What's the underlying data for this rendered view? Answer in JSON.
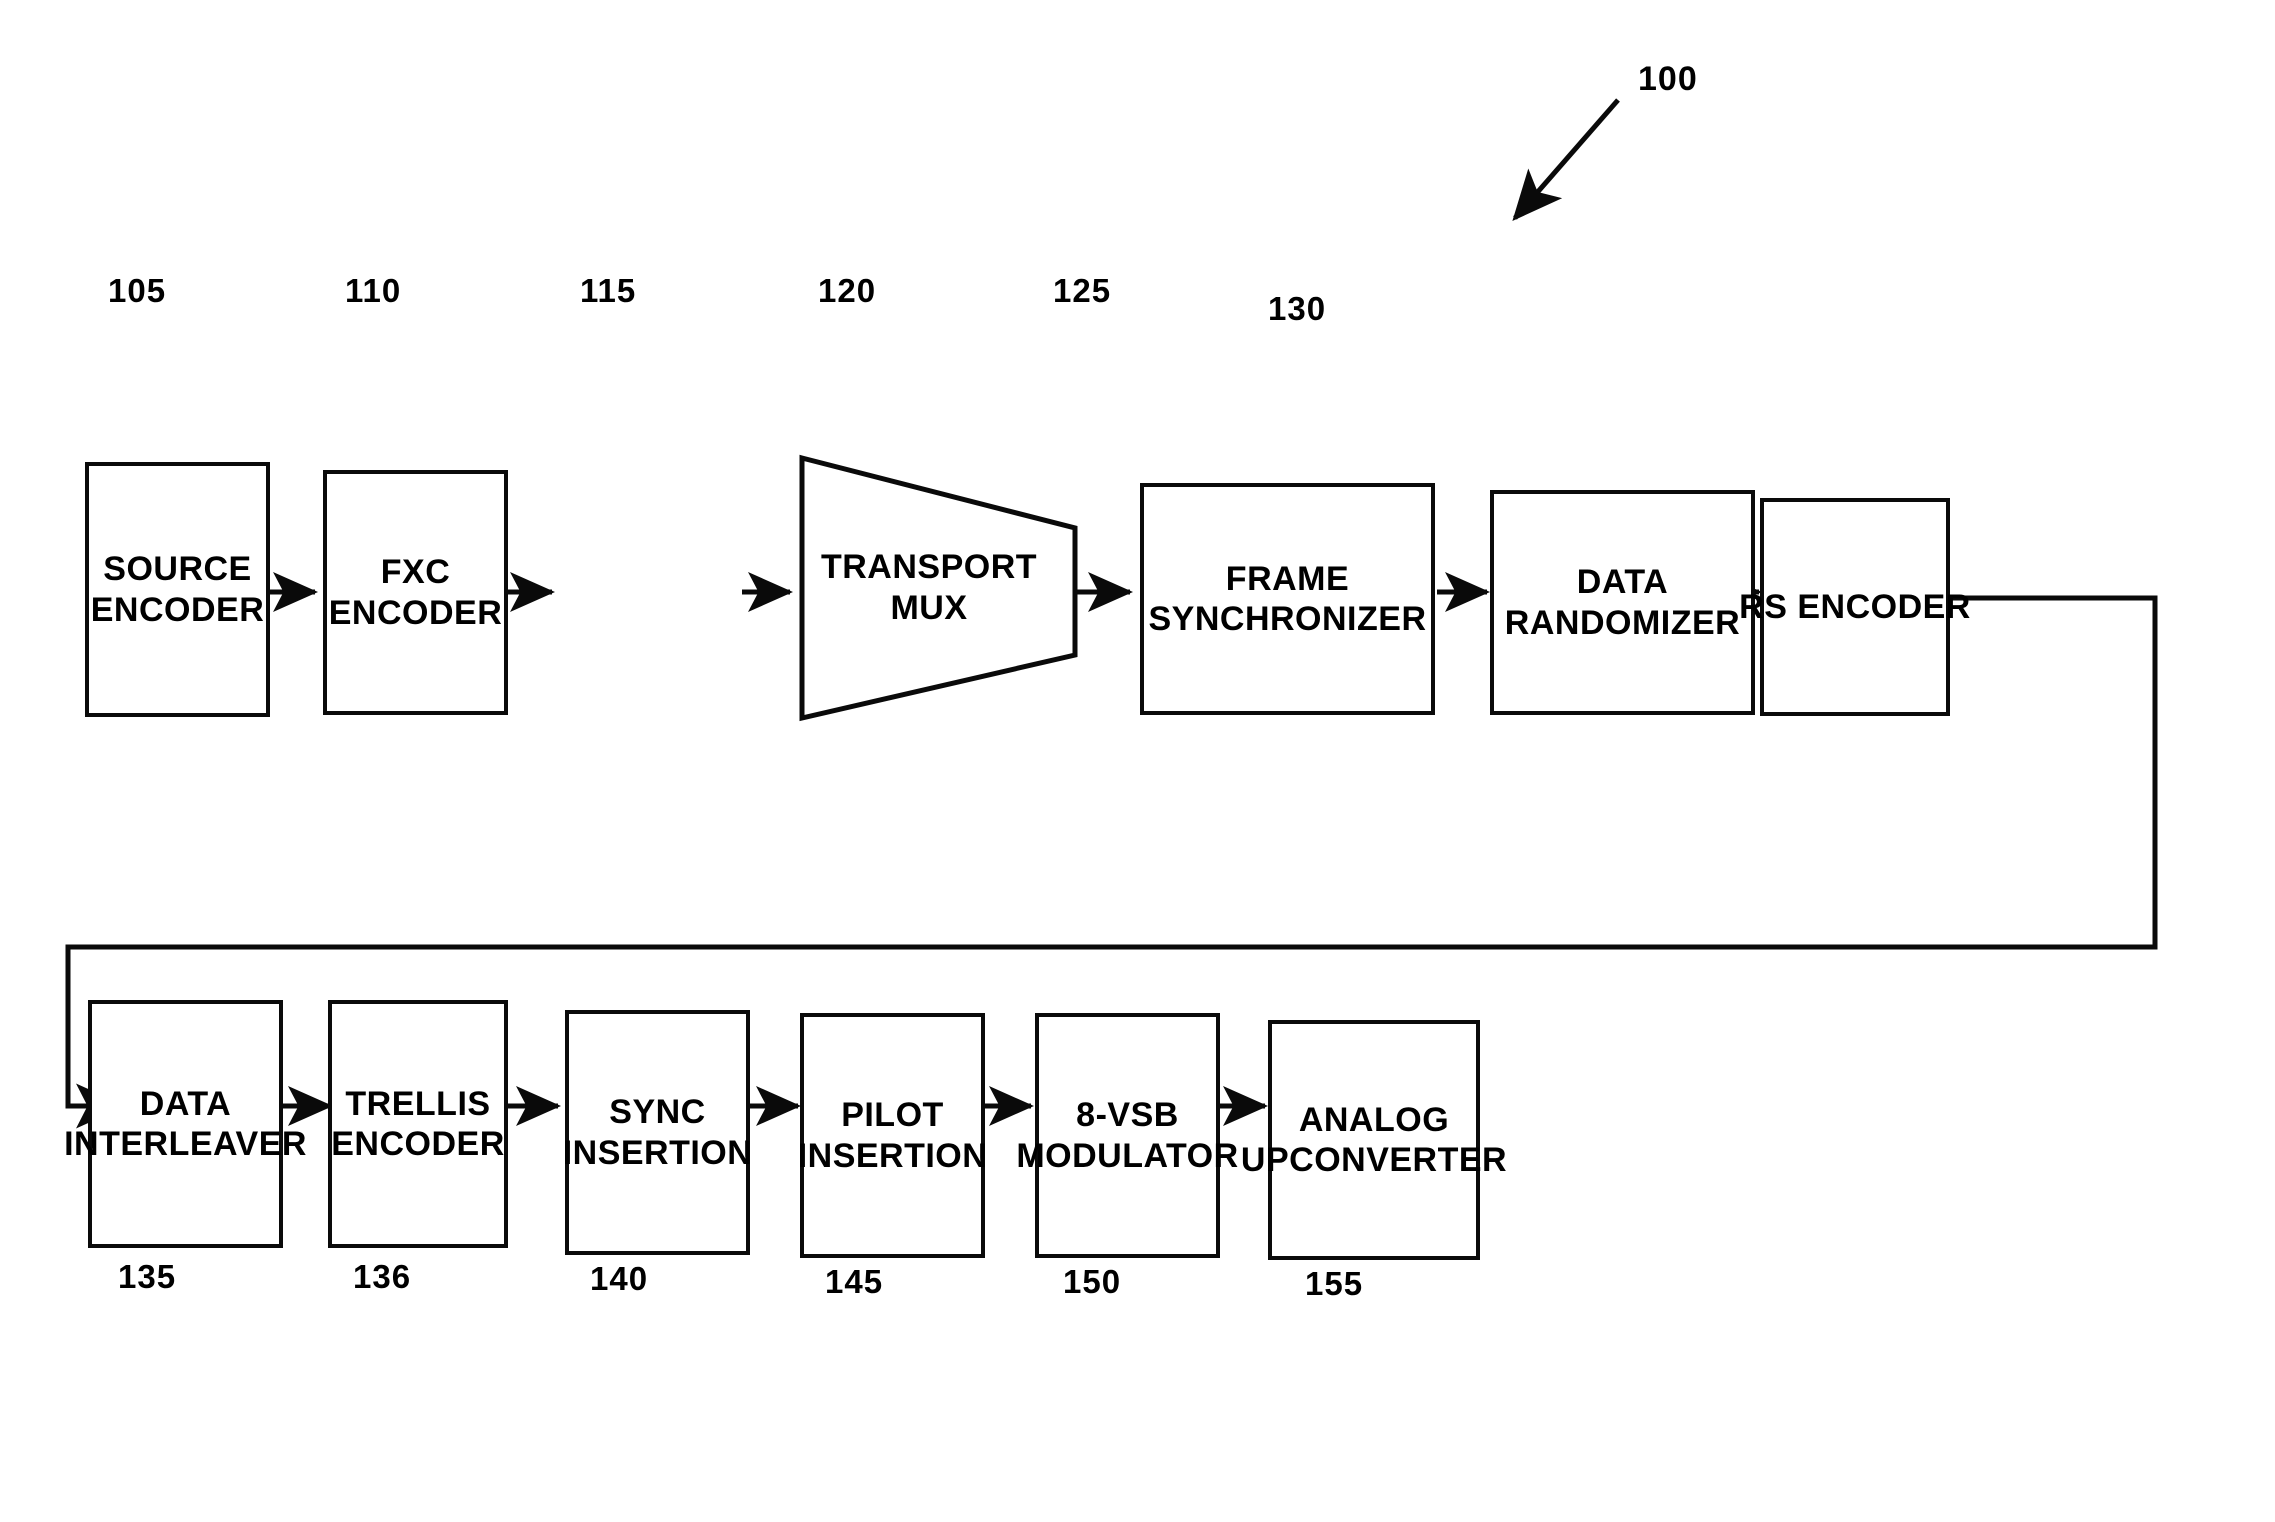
{
  "figure": {
    "number_label": "100",
    "stroke_color": "#0a0a0a",
    "background_color": "#ffffff"
  },
  "rows": {
    "row1": {
      "blocks": [
        {
          "ref": "105",
          "line1": "SOURCE",
          "line2": "ENCODER",
          "shape": "rect"
        },
        {
          "ref": "110",
          "line1": "FXC",
          "line2": "ENCODER",
          "shape": "rect"
        },
        {
          "ref": "115",
          "line1": "TRANSPORT",
          "line2": "MUX",
          "shape": "trapezoid"
        },
        {
          "ref": "120",
          "line1": "FRAME",
          "line2": "SYNCHRONIZER",
          "shape": "rect"
        },
        {
          "ref": "125",
          "line1": "DATA",
          "line2": "RANDOMIZER",
          "shape": "rect"
        },
        {
          "ref": "130",
          "line1": "RS ENCODER",
          "line2": "",
          "shape": "rect"
        }
      ]
    },
    "row2": {
      "blocks": [
        {
          "ref": "135",
          "line1": "DATA",
          "line2": "INTERLEAVER",
          "shape": "rect"
        },
        {
          "ref": "136",
          "line1": "TRELLIS",
          "line2": "ENCODER",
          "shape": "rect"
        },
        {
          "ref": "140",
          "line1": "SYNC",
          "line2": "INSERTION",
          "shape": "rect"
        },
        {
          "ref": "145",
          "line1": "PILOT",
          "line2": "INSERTION",
          "shape": "rect"
        },
        {
          "ref": "150",
          "line1": "8-VSB",
          "line2": "MODULATOR",
          "shape": "rect"
        },
        {
          "ref": "155",
          "line1": "ANALOG",
          "line2": "UPCONVERTER",
          "shape": "rect"
        }
      ]
    }
  }
}
